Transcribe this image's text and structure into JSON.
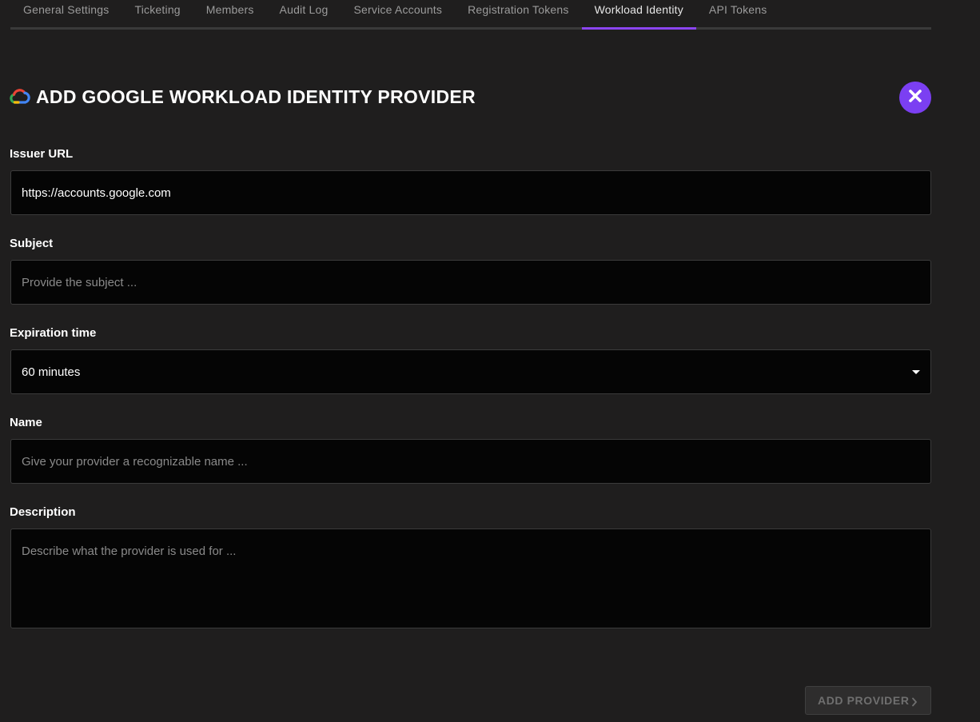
{
  "tabs": [
    {
      "label": "General Settings",
      "active": false
    },
    {
      "label": "Ticketing",
      "active": false
    },
    {
      "label": "Members",
      "active": false
    },
    {
      "label": "Audit Log",
      "active": false
    },
    {
      "label": "Service Accounts",
      "active": false
    },
    {
      "label": "Registration Tokens",
      "active": false
    },
    {
      "label": "Workload Identity",
      "active": true
    },
    {
      "label": "API Tokens",
      "active": false
    }
  ],
  "header": {
    "title": "ADD GOOGLE WORKLOAD IDENTITY PROVIDER",
    "icon": "google-cloud-icon",
    "close_icon": "close-icon"
  },
  "form": {
    "issuer_url": {
      "label": "Issuer URL",
      "value": "https://accounts.google.com"
    },
    "subject": {
      "label": "Subject",
      "placeholder": "Provide the subject ..."
    },
    "expiration": {
      "label": "Expiration time",
      "value": "60 minutes"
    },
    "name": {
      "label": "Name",
      "placeholder": "Give your provider a recognizable name ..."
    },
    "description": {
      "label": "Description",
      "placeholder": "Describe what the provider is used for ..."
    }
  },
  "actions": {
    "add_provider_label": "ADD PROVIDER"
  },
  "colors": {
    "accent": "#8b45f0",
    "close_button": "#7b3ff2",
    "background": "#1f1e1e",
    "input_background": "#050505"
  }
}
